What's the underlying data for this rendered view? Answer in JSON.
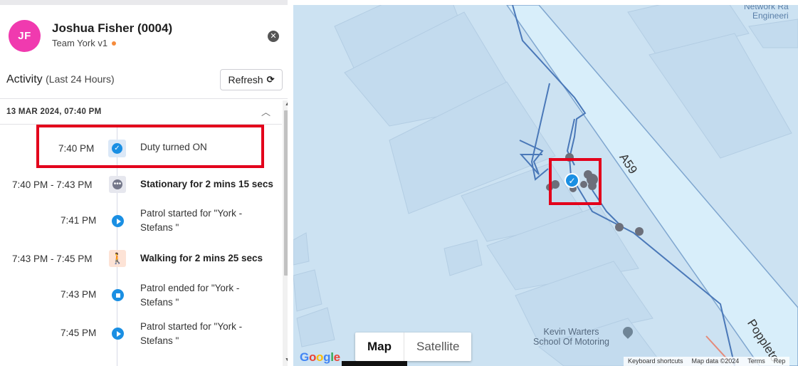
{
  "user": {
    "initials": "JF",
    "name": "Joshua Fisher (0004)",
    "team": "Team York v1"
  },
  "activity": {
    "title": "Activity",
    "subtitle": "(Last 24 Hours)",
    "refresh_label": "Refresh",
    "date_header": "13 MAR 2024, 07:40 PM",
    "items": [
      {
        "time": "7:40 PM",
        "text": "Duty turned ON",
        "icon": "check-icon",
        "bold": false
      },
      {
        "time": "7:40 PM - 7:43 PM",
        "text": "Stationary for 2 mins 15 secs",
        "icon": "more-dots-icon",
        "bold": true
      },
      {
        "time": "7:41 PM",
        "text": "Patrol started for \"York - Stefans \"",
        "icon": "play-icon",
        "bold": false
      },
      {
        "time": "7:43 PM - 7:45 PM",
        "text": "Walking for 2 mins 25 secs",
        "icon": "walking-icon",
        "bold": true
      },
      {
        "time": "7:43 PM",
        "text": "Patrol ended for \"York - Stefans \"",
        "icon": "stop-icon",
        "bold": false
      },
      {
        "time": "7:45 PM",
        "text": "Patrol started for \"York - Stefans \"",
        "icon": "play-icon",
        "bold": false
      }
    ]
  },
  "map": {
    "mode_options": [
      "Map",
      "Satellite"
    ],
    "active_mode": "Map",
    "labels": {
      "network_engineering": "Network Ra\nEngineeri",
      "school": "Kevin Warters\nSchool Of Motoring",
      "road_a59": "A59",
      "road_poppleton": "Poppleto"
    },
    "attribution": {
      "shortcuts": "Keyboard shortcuts",
      "map_data": "Map data ©2024",
      "terms": "Terms",
      "report": "Rep"
    },
    "google_logo": "Google"
  },
  "colors": {
    "accent": "#1a8fe3",
    "avatar": "#f03aaf",
    "team_status": "#f58b3c",
    "highlight": "#e3001b",
    "map_bg": "#cce2f2"
  }
}
